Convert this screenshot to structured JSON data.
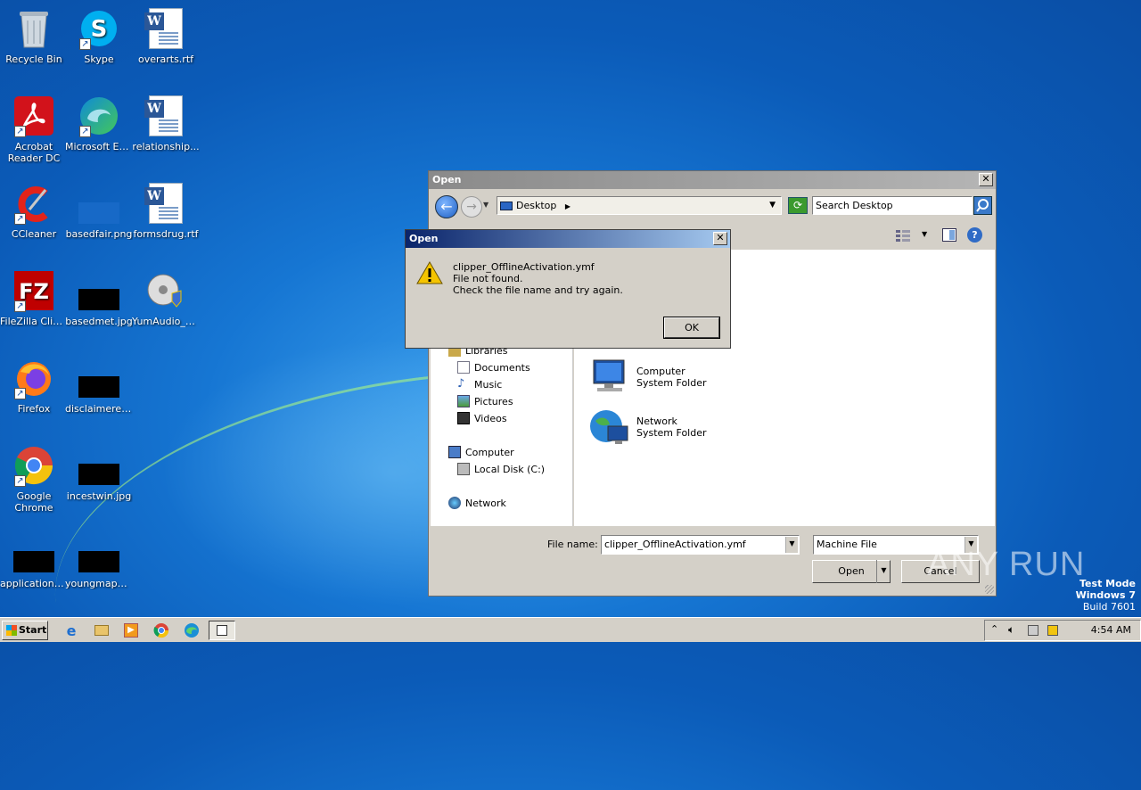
{
  "desktop": {
    "icons": [
      {
        "label": "Recycle Bin",
        "icon": "recycle-bin-icon"
      },
      {
        "label": "Skype",
        "icon": "skype-icon"
      },
      {
        "label": "overarts.rtf",
        "icon": "word-document-icon"
      },
      {
        "label": "Acrobat Reader DC",
        "icon": "acrobat-icon"
      },
      {
        "label": "Microsoft Edge",
        "icon": "edge-icon"
      },
      {
        "label": "relationship...",
        "icon": "word-document-icon"
      },
      {
        "label": "CCleaner",
        "icon": "ccleaner-icon"
      },
      {
        "label": "basedfair.png",
        "icon": "image-thumbnail-icon"
      },
      {
        "label": "formsdrug.rtf",
        "icon": "word-document-icon"
      },
      {
        "label": "FileZilla Client",
        "icon": "filezilla-icon"
      },
      {
        "label": "basedmet.jpg",
        "icon": "image-thumbnail-icon"
      },
      {
        "label": "YumAudio_K...",
        "icon": "installer-icon"
      },
      {
        "label": "Firefox",
        "icon": "firefox-icon"
      },
      {
        "label": "disclaimerev...",
        "icon": "image-thumbnail-icon"
      },
      {
        "label": "Google Chrome",
        "icon": "chrome-icon"
      },
      {
        "label": "incestwin.jpg",
        "icon": "image-thumbnail-icon"
      },
      {
        "label": "applications...",
        "icon": "image-thumbnail-icon"
      },
      {
        "label": "youngmapu...",
        "icon": "image-thumbnail-icon"
      }
    ]
  },
  "open_dialog": {
    "title": "Open",
    "location": "Desktop",
    "search_placeholder": "Search Desktop",
    "tree": {
      "libraries": "Libraries",
      "documents": "Documents",
      "music": "Music",
      "pictures": "Pictures",
      "videos": "Videos",
      "computer": "Computer",
      "local_disk": "Local Disk (C:)",
      "network": "Network"
    },
    "items": [
      {
        "name": "Computer",
        "type": "System Folder"
      },
      {
        "name": "Network",
        "type": "System Folder"
      }
    ],
    "file_name_label": "File name:",
    "file_name_value": "clipper_OfflineActivation.ymf",
    "file_type": "Machine File",
    "open_button": "Open",
    "cancel_button": "Cancel"
  },
  "error_dialog": {
    "title": "Open",
    "filename": "clipper_OfflineActivation.ymf",
    "line2": "File not found.",
    "line3": "Check the file name and try again.",
    "ok_button": "OK"
  },
  "watermark": {
    "brand": "ANY RUN",
    "test_mode": "Test Mode",
    "os": "Windows 7",
    "build": "Build 7601"
  },
  "taskbar": {
    "start_label": "Start",
    "clock": "4:54 AM"
  }
}
